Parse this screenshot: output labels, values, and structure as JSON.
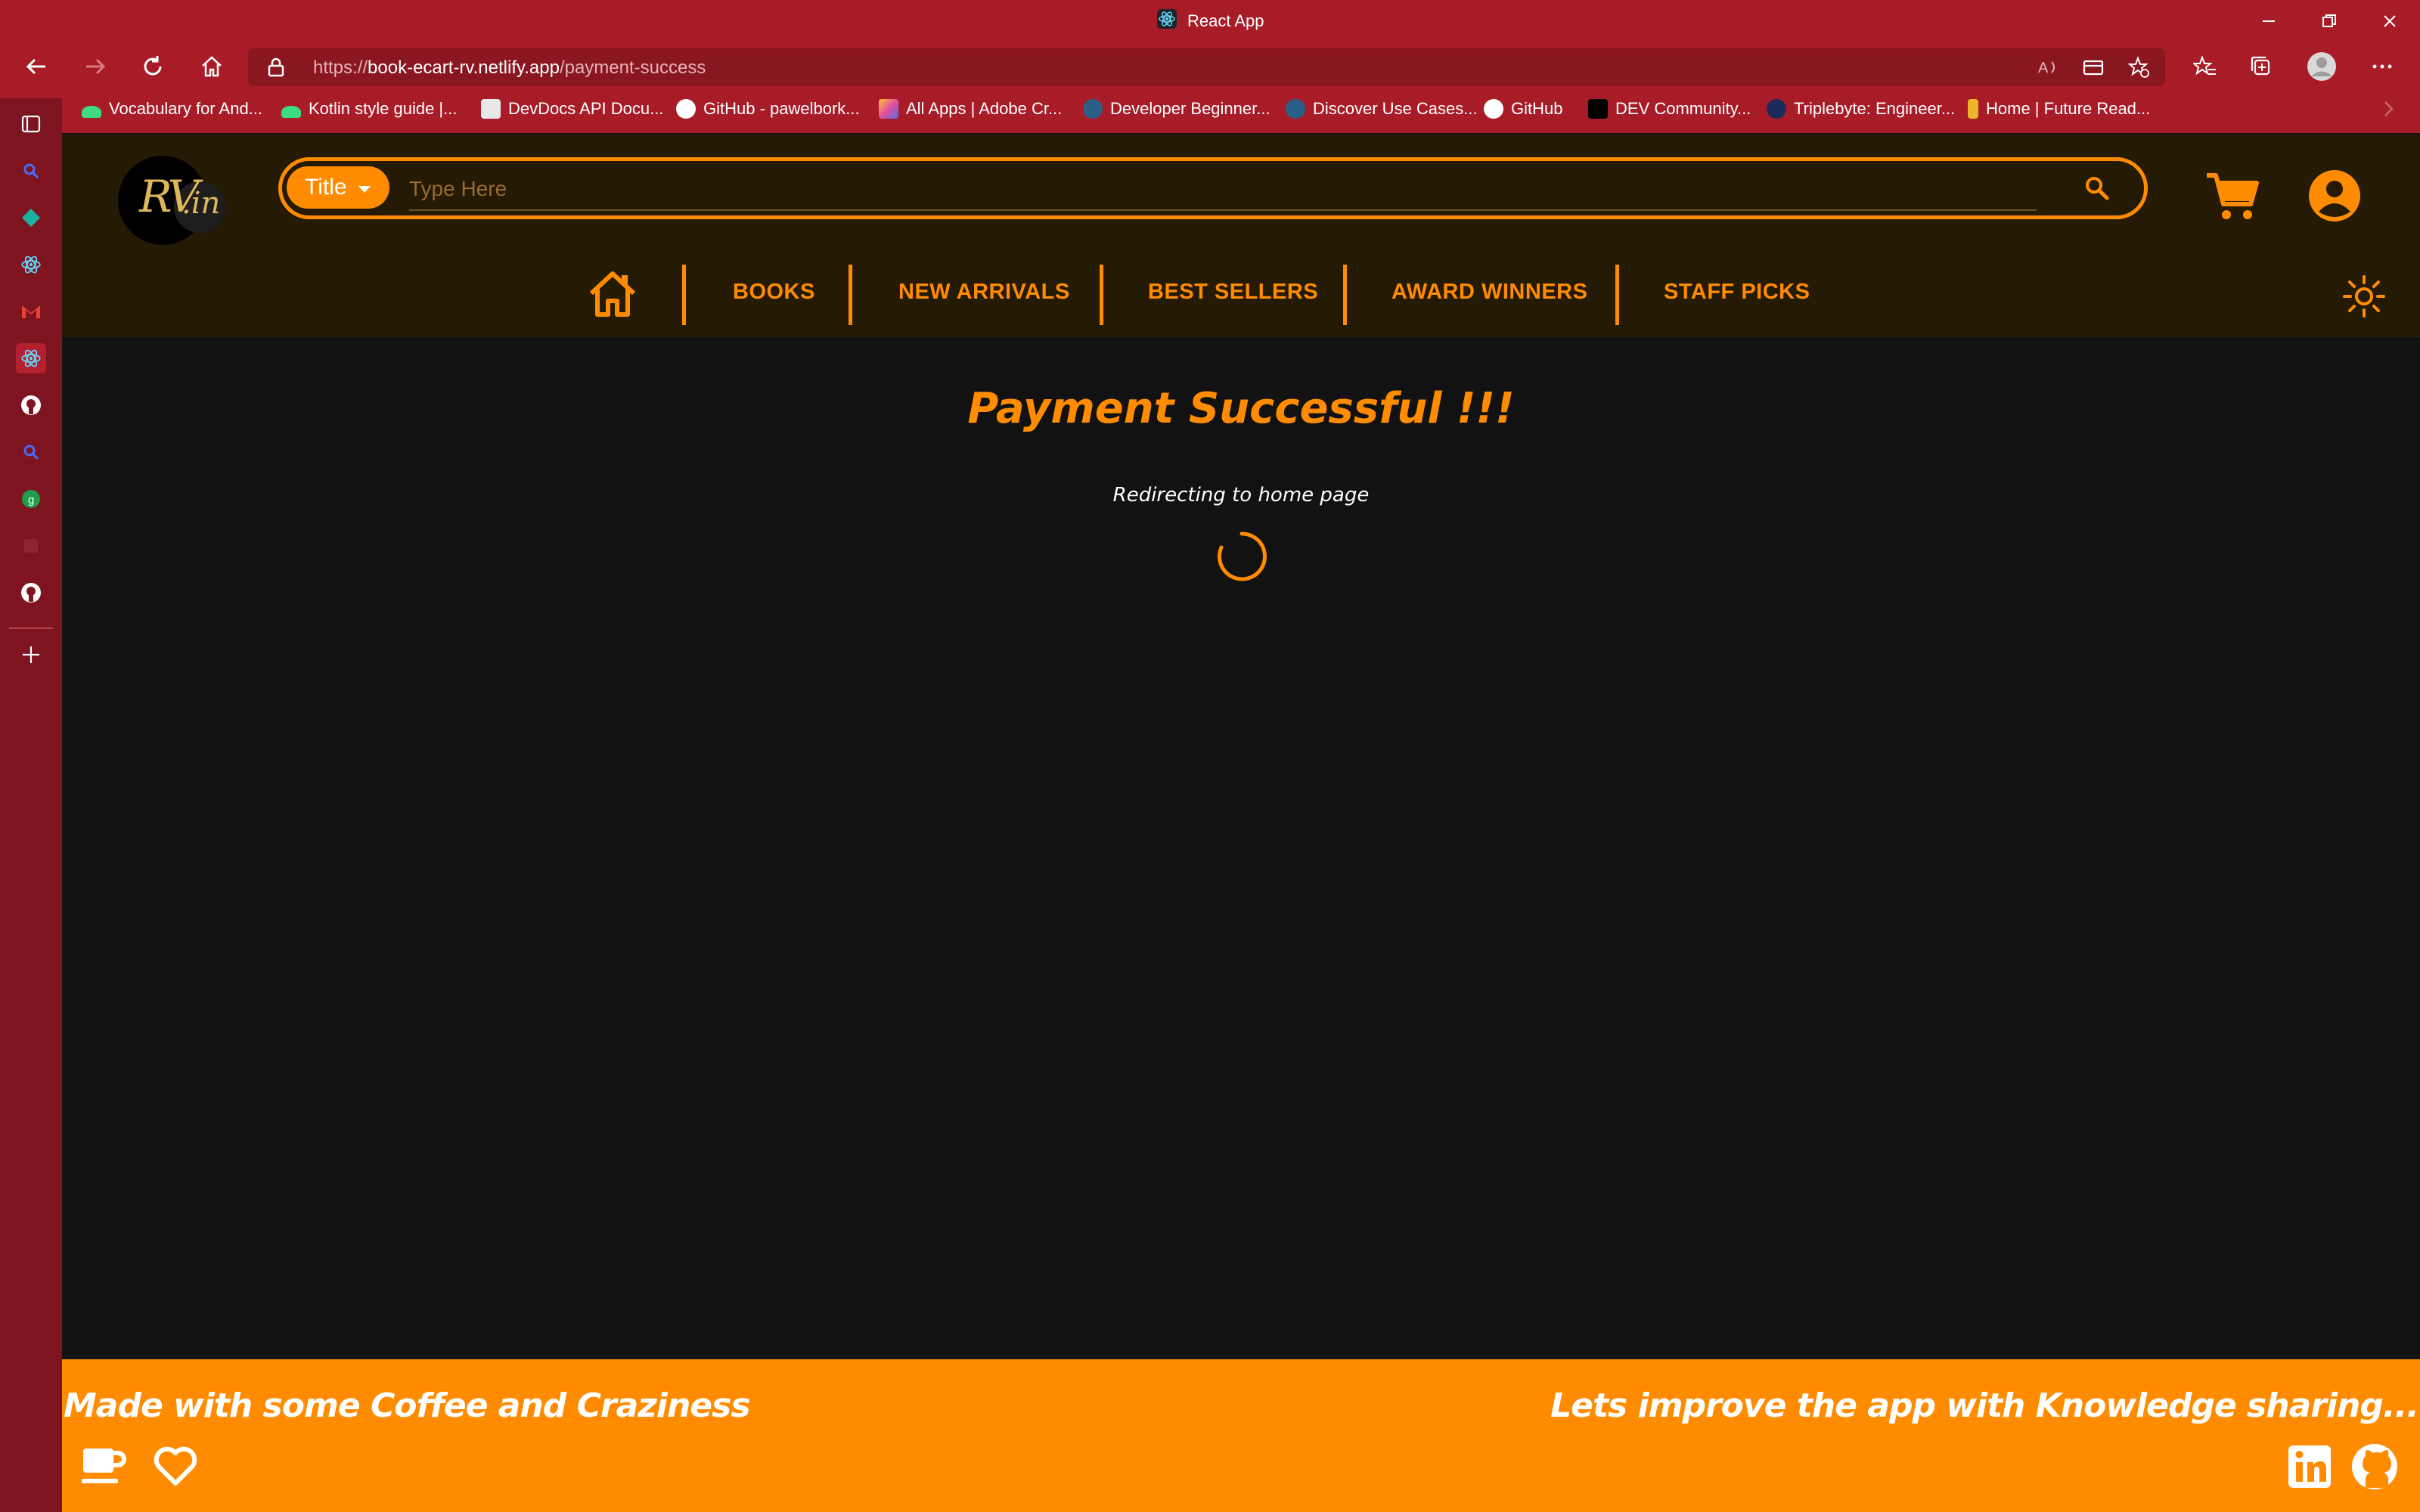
{
  "browser": {
    "tab_title": "React App",
    "url": {
      "scheme": "https://",
      "host": "book-ecart-rv.netlify.app",
      "path": "/payment-success"
    },
    "bookmarks": [
      {
        "label": "Vocabulary for And...",
        "icon": "android-icon",
        "color": "#3ddc84"
      },
      {
        "label": "Kotlin style guide |...",
        "icon": "android-icon",
        "color": "#3ddc84"
      },
      {
        "label": "DevDocs API Docu...",
        "icon": "devdocs-icon",
        "color": "#e8e8e8"
      },
      {
        "label": "GitHub - pawelbork...",
        "icon": "github-icon",
        "color": "#ffffff"
      },
      {
        "label": "All Apps | Adobe Cr...",
        "icon": "adobe-icon",
        "color": "#e34fa0"
      },
      {
        "label": "Developer Beginner...",
        "icon": "triangle-icon",
        "color": "#4aa3df"
      },
      {
        "label": "Discover Use Cases...",
        "icon": "triangle-icon",
        "color": "#4aa3df"
      },
      {
        "label": "GitHub",
        "icon": "github-icon",
        "color": "#ffffff"
      },
      {
        "label": "DEV Community...",
        "icon": "dev-icon",
        "color": "#000000"
      },
      {
        "label": "Triplebyte: Engineer...",
        "icon": "triplebyte-icon",
        "color": "#1d2a5c"
      },
      {
        "label": "Home | Future Read...",
        "icon": "future-icon",
        "color": "#f0b429"
      }
    ]
  },
  "header": {
    "logo_main": "RV",
    "logo_suffix": ".in",
    "filter_label": "Title",
    "search_placeholder": "Type Here"
  },
  "menu": {
    "items": [
      "BOOKS",
      "NEW ARRIVALS",
      "BEST SELLERS",
      "AWARD WINNERS",
      "STAFF PICKS"
    ]
  },
  "main": {
    "title": "Payment Successful !!!",
    "subtitle": "Redirecting to home page"
  },
  "footer": {
    "left_text": "Made with some Coffee and Craziness",
    "right_text": "Lets improve the app with Knowledge sharing..."
  },
  "colors": {
    "accent": "#ff8c00",
    "browser_chrome": "#a71c27",
    "header_bg": "#251a03",
    "page_bg": "#121212"
  }
}
